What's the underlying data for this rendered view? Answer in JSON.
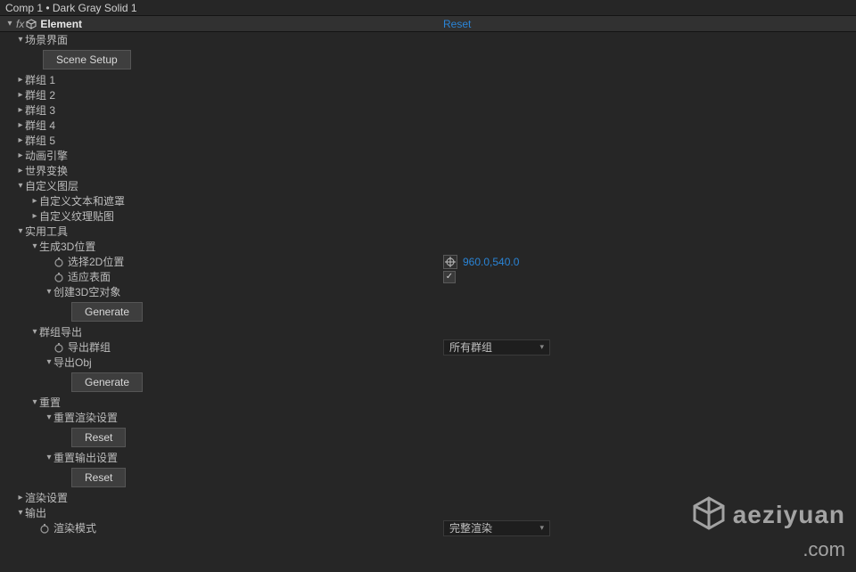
{
  "titlebar": "Comp 1 • Dark Gray Solid 1",
  "fx": {
    "prefix": "fx",
    "name": "Element",
    "reset": "Reset"
  },
  "scene_interface": {
    "label": "场景界面",
    "scene_setup_btn": "Scene Setup"
  },
  "groups": [
    "群组 1",
    "群组 2",
    "群组 3",
    "群组 4",
    "群组 5"
  ],
  "anim_engine": "动画引擎",
  "world_transform": "世界变换",
  "custom_layers": {
    "label": "自定义图层",
    "text_mask": "自定义文本和遮罩",
    "texture": "自定义纹理贴图"
  },
  "utilities": {
    "label": "实用工具",
    "gen3d": {
      "label": "生成3D位置",
      "pick2d": "选择2D位置",
      "pick2d_value": "960.0,540.0",
      "fit_surface": "适应表面",
      "fit_surface_checked": true,
      "create_null": "创建3D空对象",
      "generate_btn": "Generate"
    },
    "group_export": {
      "label": "群组导出",
      "export_group": "导出群组",
      "export_group_value": "所有群组",
      "export_obj": "导出Obj",
      "generate_btn": "Generate"
    },
    "reset": {
      "label": "重置",
      "reset_render": "重置渲染设置",
      "reset_render_btn": "Reset",
      "reset_output": "重置输出设置",
      "reset_output_btn": "Reset"
    }
  },
  "render_settings": "渲染设置",
  "output": {
    "label": "输出",
    "render_mode": "渲染模式",
    "render_mode_value": "完整渲染"
  },
  "watermark": {
    "line1": "aeziyuan",
    "line2": ".com"
  }
}
